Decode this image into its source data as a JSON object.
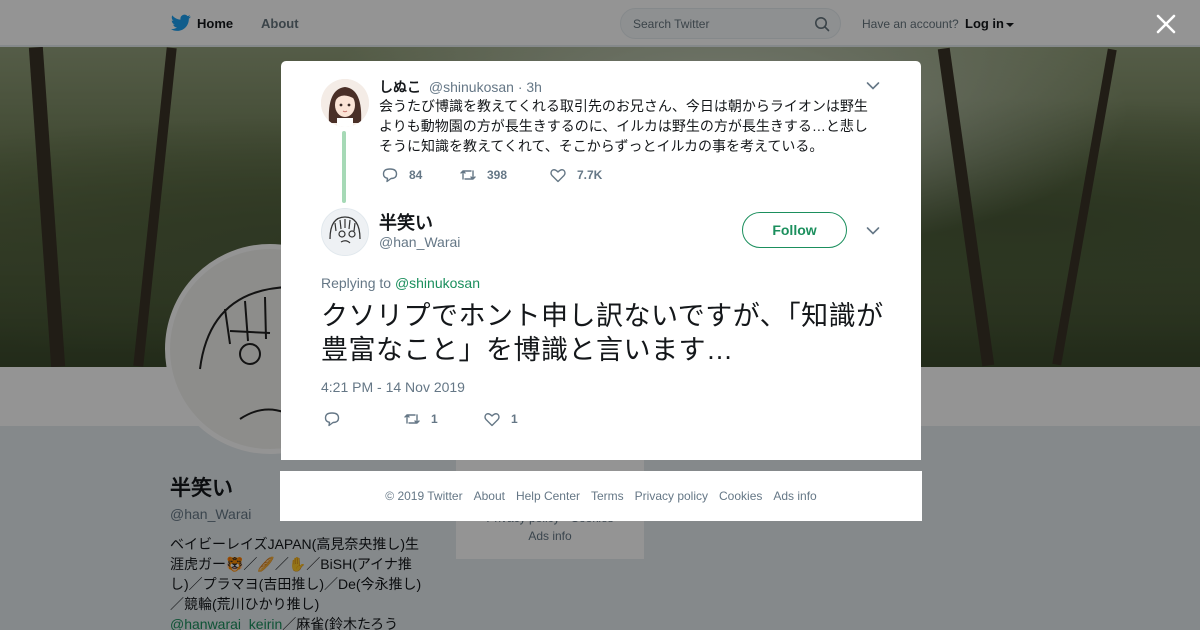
{
  "topbar": {
    "home": "Home",
    "about": "About",
    "search_placeholder": "Search Twitter",
    "have_account": "Have an account?",
    "login": "Log in"
  },
  "profile": {
    "name": "半笑い",
    "handle": "@han_Warai",
    "bio_line1": "ベイビーレイズJAPAN(高見奈央推し)生涯虎ガー🐯／🥖／✋／BiSH(アイナ推し)／プラマヨ(吉田推し)／De(今永推し)／競輪(荒川ひかり推し)",
    "bio_link": "@hanwarai_keirin",
    "bio_line2": "／麻雀(鈴木たろう",
    "side_lines": [
      "Privacy policy · Cookies",
      "Ads info"
    ]
  },
  "parent_tweet": {
    "name": "しぬこ",
    "handle": "@shinukosan",
    "time": "· 3h",
    "text": "会うたび博識を教えてくれる取引先のお兄さん、今日は朝からライオンは野生よりも動物園の方が長生きするのに、イルカは野生の方が長生きする…と悲しそうに知識を教えてくれて、そこからずっとイルカの事を考えている。",
    "replies": "84",
    "retweets": "398",
    "likes": "7.7K"
  },
  "main_tweet": {
    "name": "半笑い",
    "handle": "@han_Warai",
    "follow": "Follow",
    "replying_prefix": "Replying to ",
    "replying_to": "@shinukosan",
    "text": "クソリプでホント申し訳ないですが、「知識が豊富なこと」を博識と言います…",
    "timestamp": "4:21 PM - 14 Nov 2019",
    "retweets": "1",
    "likes": "1"
  },
  "footer": {
    "copyright": "© 2019 Twitter",
    "links": [
      "About",
      "Help Center",
      "Terms",
      "Privacy policy",
      "Cookies",
      "Ads info"
    ]
  },
  "colors": {
    "accent": "#1b8f5d",
    "thread_line": "#a6d9b6",
    "secondary_text": "#657786"
  },
  "icons": [
    "twitter-bird-icon",
    "search-icon",
    "close-icon",
    "chevron-down-icon",
    "reply-icon",
    "retweet-icon",
    "like-icon"
  ]
}
